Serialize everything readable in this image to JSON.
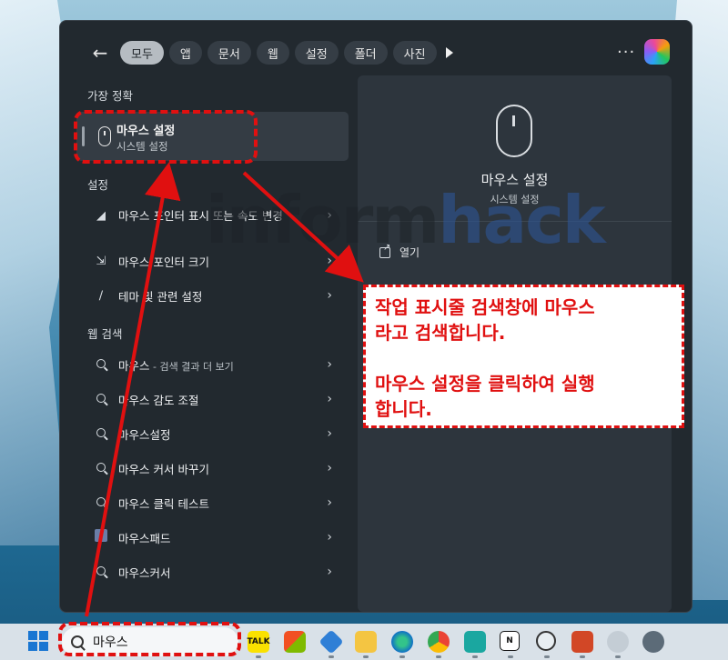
{
  "start_menu": {
    "tabs": [
      "모두",
      "앱",
      "문서",
      "웹",
      "설정",
      "폴더",
      "사진"
    ],
    "best_match": {
      "section_title": "가장 정확",
      "title": "마우스 설정",
      "subtitle": "시스템 설정"
    },
    "settings": {
      "section_title": "설정",
      "items": [
        {
          "label": "마우스 포인터 표시 또는 속도 변경",
          "icon": "mouse-speed-icon"
        },
        {
          "label": "마우스 포인터 크기",
          "icon": "pointer-size-icon"
        },
        {
          "label": "테마 및 관련 설정",
          "icon": "brush-icon"
        }
      ]
    },
    "web": {
      "section_title": "웹 검색",
      "items": [
        {
          "label": "마우스",
          "suffix": " - 검색 결과 더 보기"
        },
        {
          "label": "마우스 감도 조절",
          "suffix": ""
        },
        {
          "label": "마우스설정",
          "suffix": ""
        },
        {
          "label": "마우스 커서 바꾸기",
          "suffix": ""
        },
        {
          "label": "마우스 클릭 테스트",
          "suffix": ""
        },
        {
          "label": "마우스패드",
          "suffix": ""
        },
        {
          "label": "마우스커서",
          "suffix": ""
        }
      ]
    },
    "preview": {
      "title": "마우스 설정",
      "subtitle": "시스템 설정",
      "open_label": "열기"
    }
  },
  "watermark": {
    "part1": "inform",
    "part2": "hack"
  },
  "taskbar": {
    "search_query": "마우스",
    "apps": [
      "kakaotalk",
      "microsoft-store",
      "azure",
      "file-explorer",
      "edge",
      "chrome",
      "app",
      "notion",
      "app",
      "powerpoint",
      "settings"
    ]
  },
  "annotation": {
    "line1": "작업 표시줄 검색창에 마우스",
    "line2": "라고 검색합니다.",
    "line3": "마우스 설정을 클릭하여 실행",
    "line4": "합니다.",
    "color": "#e01010"
  }
}
